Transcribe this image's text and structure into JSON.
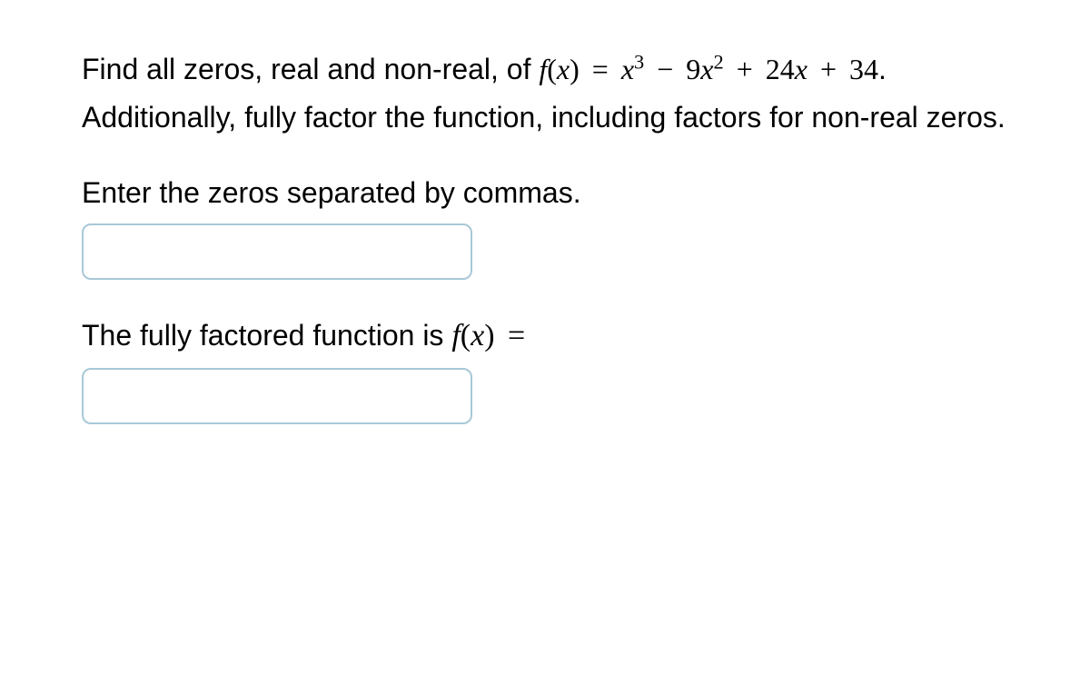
{
  "question": {
    "intro": "Find all zeros, real and non-real, of ",
    "after_formula": ". Additionally, fully factor the function, including factors for non-real zeros.",
    "formula": {
      "fn_var": "f",
      "arg": "x",
      "term1_var": "x",
      "term1_exp": "3",
      "coef2": "9",
      "term2_var": "x",
      "term2_exp": "2",
      "coef3": "24",
      "term3_var": "x",
      "const": "34"
    }
  },
  "instruction1": "Enter the zeros separated by commas.",
  "factored": {
    "label_before": "The fully factored function is ",
    "fn_var": "f",
    "arg": "x"
  },
  "inputs": {
    "zeros_value": "",
    "factored_value": ""
  }
}
